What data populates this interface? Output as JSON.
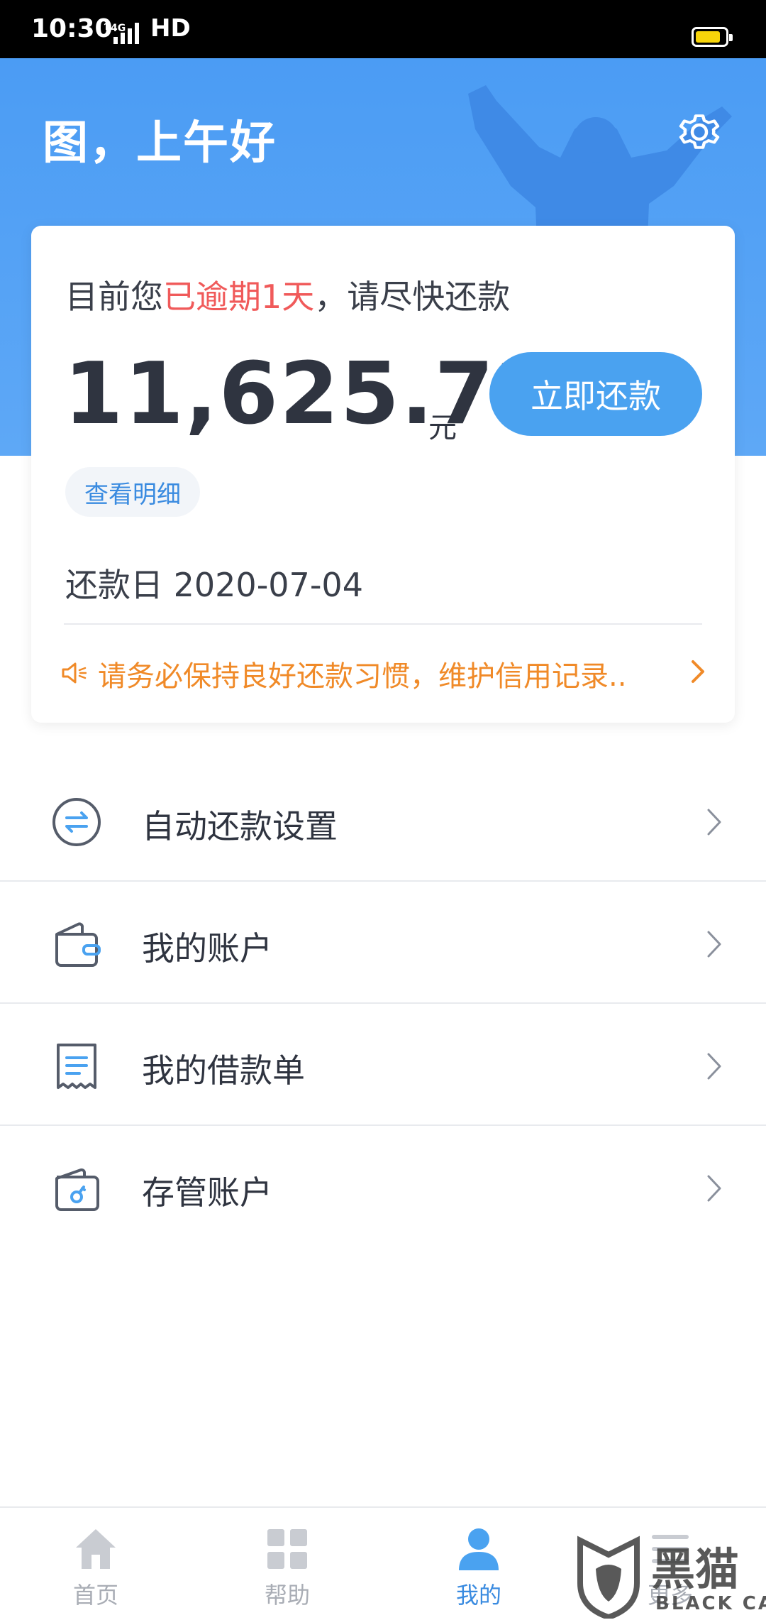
{
  "status_bar": {
    "time": "10:30",
    "network": "4G",
    "hd": "HD",
    "battery_color": "#f7d40a"
  },
  "header": {
    "greeting": "图，上午好",
    "settings_icon": "gear-icon"
  },
  "card": {
    "status_prefix": "目前您",
    "status_overdue": "已逾期1天",
    "status_suffix": "，请尽快还款",
    "amount": "11,625.72",
    "amount_unit": "元",
    "pay_button": "立即还款",
    "detail_link": "查看明细",
    "due_date_label": "还款日",
    "due_date": "2020-07-04",
    "notice": "请务必保持良好还款习惯，维护信用记录..",
    "notice_icon": "speaker-icon"
  },
  "menu": [
    {
      "label": "自动还款设置",
      "icon": "auto-repay-icon"
    },
    {
      "label": "我的账户",
      "icon": "wallet-icon"
    },
    {
      "label": "我的借款单",
      "icon": "receipt-icon"
    },
    {
      "label": "存管账户",
      "icon": "custody-icon"
    }
  ],
  "bottom_nav": [
    {
      "label": "首页",
      "icon": "home-icon",
      "active": false
    },
    {
      "label": "帮助",
      "icon": "grid-icon",
      "active": false
    },
    {
      "label": "我的",
      "icon": "user-icon",
      "active": true
    },
    {
      "label": "更多",
      "icon": "more-icon",
      "active": false
    }
  ],
  "watermark": {
    "chars": "黑猫",
    "en": "BLACK CAT"
  },
  "colors": {
    "primary": "#4aa2f0",
    "overdue_red": "#f05a5a",
    "notice_orange": "#f08a28",
    "link_blue": "#3a8be0"
  }
}
